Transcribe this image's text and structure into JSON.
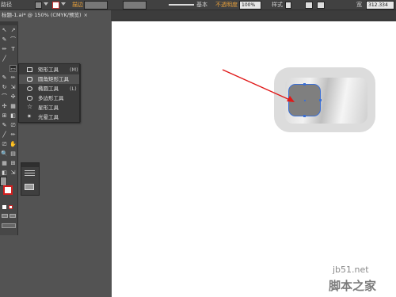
{
  "control_bar": {
    "left_label": "路径",
    "stroke_label": "描边",
    "stroke_style_label": "基本",
    "opacity_label": "不透明度",
    "opacity_value": "100%",
    "style_label": "样式",
    "width_label": "宽",
    "width_value": "312.334"
  },
  "document": {
    "tab_title": "标题-1.ai* @ 150% (CMYK/预览)",
    "close": "×"
  },
  "tools": {
    "glyphs": [
      "↖",
      "↗",
      "✎",
      "T",
      "╱",
      "▭",
      "✏",
      "⌒",
      "↻",
      "⇲",
      "✣",
      "▦",
      "⊞",
      "◧",
      "⎚",
      "✋",
      "🔍",
      "▤"
    ]
  },
  "flyout": {
    "items": [
      {
        "label": "矩形工具",
        "key": "(M)"
      },
      {
        "label": "圆角矩形工具",
        "key": ""
      },
      {
        "label": "椭圆工具",
        "key": "(L)"
      },
      {
        "label": "多边形工具",
        "key": ""
      },
      {
        "label": "星形工具",
        "key": ""
      },
      {
        "label": "光晕工具",
        "key": ""
      }
    ]
  },
  "watermark": {
    "line1": "jb51.net",
    "line2": "脚本之家"
  }
}
